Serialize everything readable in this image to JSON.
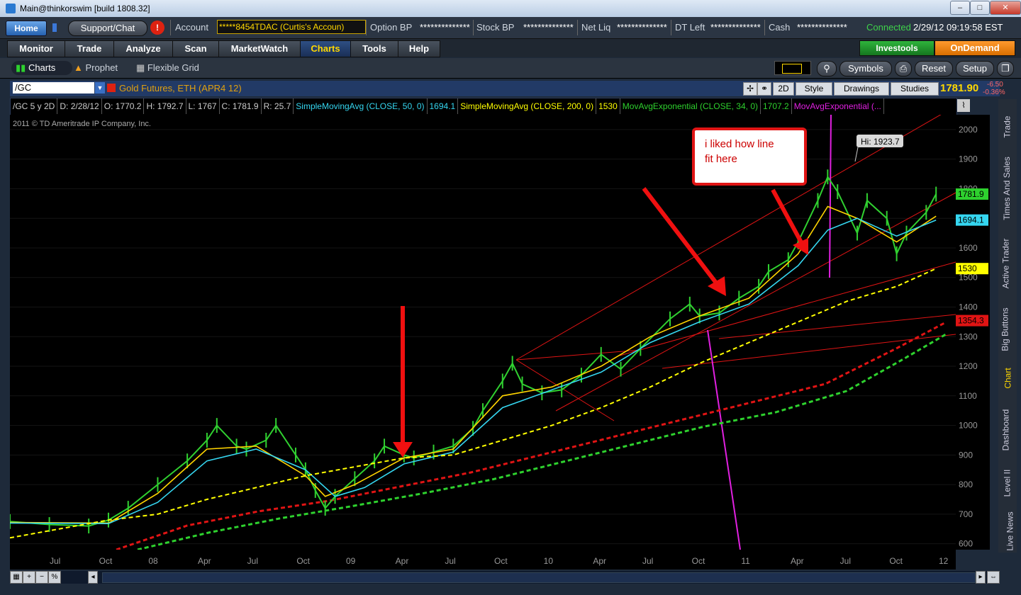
{
  "window": {
    "title": "Main@thinkorswim [build 1808.32]",
    "min": "–",
    "max": "□",
    "close": "✕"
  },
  "topbar": {
    "home": "Home",
    "support": "Support/Chat",
    "alert": "!",
    "account_label": "Account",
    "account_value": "*****8454TDAC (Curtis's Accoun)",
    "option_bp_label": "Option BP",
    "option_bp_value": "**************",
    "stock_bp_label": "Stock BP",
    "stock_bp_value": "**************",
    "netliq_label": "Net Liq",
    "netliq_value": "**************",
    "dtleft_label": "DT Left",
    "dtleft_value": "**************",
    "cash_label": "Cash",
    "cash_value": "**************",
    "connected": "Connected",
    "clock": "2/29/12 09:19:58 EST"
  },
  "tabs": [
    "Monitor",
    "Trade",
    "Analyze",
    "Scan",
    "MarketWatch",
    "Charts",
    "Tools",
    "Help"
  ],
  "investools": "Investools",
  "ondemand": "OnDemand",
  "subtabs": {
    "charts": "Charts",
    "prophet": "Prophet",
    "grid": "Flexible Grid"
  },
  "toolbar": {
    "symbols": "Symbols",
    "reset": "Reset",
    "setup": "Setup"
  },
  "symbol": {
    "ticker": "/GC",
    "description": "Gold Futures, ETH (APR4 12)",
    "price": "1781.90",
    "change": "-6.50",
    "change_pct": "-0.36%"
  },
  "charttools": {
    "mode": "2D",
    "style": "Style",
    "drawings": "Drawings",
    "studies": "Studies"
  },
  "studies": {
    "sym": "/GC 5 y 2D",
    "d": "D: 2/28/12",
    "o": "O: 1770.2",
    "h": "H: 1792.7",
    "l": "L: 1767",
    "c": "C: 1781.9",
    "r": "R: 25.7",
    "sma50": "SimpleMovingAvg (CLOSE, 50, 0)",
    "sma50v": "1694.1",
    "sma200": "SimpleMovingAvg (CLOSE, 200, 0)",
    "sma200v": "1530",
    "ema34": "MovAvgExponential (CLOSE, 34, 0)",
    "ema34v": "1707.2",
    "ema2": "MovAvgExponential (..."
  },
  "chart": {
    "copyright": "2011 © TD Ameritrade IP Company, Inc.",
    "hi_label": "Hi: 1923.7",
    "annotation_line1": "i liked how line",
    "annotation_line2": "fit here"
  },
  "chart_data": {
    "type": "line",
    "title": "/GC 5 y 2D",
    "y_ticks": [
      2000,
      1900,
      1800,
      1700,
      1600,
      1500,
      1400,
      1300,
      1200,
      1100,
      1000,
      900,
      800,
      700,
      600
    ],
    "ylim": [
      580,
      2050
    ],
    "x_ticks": [
      "Jul",
      "Oct",
      "08",
      "Apr",
      "Jul",
      "Oct",
      "09",
      "Apr",
      "Jul",
      "Oct",
      "10",
      "Apr",
      "Jul",
      "Oct",
      "11",
      "Apr",
      "Jul",
      "Oct",
      "12"
    ],
    "price_labels": [
      {
        "value": "1781.9",
        "color": "#2ed12e"
      },
      {
        "value": "1694.1",
        "color": "#35d6f0"
      },
      {
        "value": "1530",
        "color": "#ffff00"
      },
      {
        "value": "1354.3",
        "color": "#e01414"
      }
    ],
    "series": [
      {
        "name": "price",
        "color": "#30d030",
        "points": [
          [
            0,
            675
          ],
          [
            4,
            665
          ],
          [
            8,
            660
          ],
          [
            10,
            680
          ],
          [
            12,
            720
          ],
          [
            15,
            800
          ],
          [
            18,
            880
          ],
          [
            20,
            950
          ],
          [
            21,
            1000
          ],
          [
            23,
            930
          ],
          [
            24,
            920
          ],
          [
            26,
            950
          ],
          [
            27,
            1000
          ],
          [
            29,
            900
          ],
          [
            30,
            850
          ],
          [
            31,
            780
          ],
          [
            32,
            720
          ],
          [
            33,
            760
          ],
          [
            35,
            820
          ],
          [
            37,
            880
          ],
          [
            38,
            930
          ],
          [
            40,
            900
          ],
          [
            41,
            890
          ],
          [
            43,
            910
          ],
          [
            45,
            930
          ],
          [
            47,
            990
          ],
          [
            48,
            1050
          ],
          [
            50,
            1150
          ],
          [
            51,
            1210
          ],
          [
            52,
            1140
          ],
          [
            54,
            1110
          ],
          [
            56,
            1120
          ],
          [
            58,
            1170
          ],
          [
            60,
            1240
          ],
          [
            62,
            1190
          ],
          [
            64,
            1260
          ],
          [
            67,
            1360
          ],
          [
            69,
            1410
          ],
          [
            70,
            1370
          ],
          [
            72,
            1380
          ],
          [
            74,
            1430
          ],
          [
            76,
            1470
          ],
          [
            77,
            1520
          ],
          [
            79,
            1560
          ],
          [
            80,
            1620
          ],
          [
            82,
            1760
          ],
          [
            83,
            1840
          ],
          [
            84,
            1790
          ],
          [
            86,
            1650
          ],
          [
            87,
            1760
          ],
          [
            89,
            1700
          ],
          [
            90,
            1580
          ],
          [
            91,
            1650
          ],
          [
            93,
            1720
          ],
          [
            94,
            1781.9
          ]
        ]
      },
      {
        "name": "EMA 34",
        "color": "#ffd400",
        "points": [
          [
            0,
            672
          ],
          [
            10,
            670
          ],
          [
            15,
            770
          ],
          [
            20,
            920
          ],
          [
            25,
            930
          ],
          [
            30,
            830
          ],
          [
            32,
            760
          ],
          [
            35,
            800
          ],
          [
            40,
            890
          ],
          [
            45,
            920
          ],
          [
            50,
            1100
          ],
          [
            55,
            1130
          ],
          [
            60,
            1200
          ],
          [
            65,
            1300
          ],
          [
            70,
            1370
          ],
          [
            75,
            1430
          ],
          [
            80,
            1580
          ],
          [
            83,
            1740
          ],
          [
            86,
            1700
          ],
          [
            90,
            1620
          ],
          [
            94,
            1707.2
          ]
        ]
      },
      {
        "name": "SMA 50",
        "color": "#35d6f0",
        "points": [
          [
            0,
            670
          ],
          [
            10,
            668
          ],
          [
            15,
            740
          ],
          [
            20,
            880
          ],
          [
            25,
            920
          ],
          [
            30,
            850
          ],
          [
            33,
            760
          ],
          [
            36,
            790
          ],
          [
            40,
            870
          ],
          [
            45,
            910
          ],
          [
            50,
            1060
          ],
          [
            55,
            1120
          ],
          [
            60,
            1180
          ],
          [
            65,
            1280
          ],
          [
            70,
            1350
          ],
          [
            75,
            1410
          ],
          [
            80,
            1540
          ],
          [
            83,
            1660
          ],
          [
            86,
            1700
          ],
          [
            90,
            1640
          ],
          [
            94,
            1694.1
          ]
        ]
      },
      {
        "name": "SMA 200",
        "color": "#ffff00",
        "points": [
          [
            0,
            620
          ],
          [
            10,
            680
          ],
          [
            15,
            700
          ],
          [
            20,
            750
          ],
          [
            25,
            790
          ],
          [
            30,
            830
          ],
          [
            35,
            860
          ],
          [
            40,
            890
          ],
          [
            45,
            900
          ],
          [
            50,
            950
          ],
          [
            55,
            1000
          ],
          [
            60,
            1060
          ],
          [
            65,
            1130
          ],
          [
            70,
            1210
          ],
          [
            75,
            1280
          ],
          [
            80,
            1350
          ],
          [
            85,
            1420
          ],
          [
            90,
            1470
          ],
          [
            94,
            1530
          ]
        ]
      }
    ]
  }
}
